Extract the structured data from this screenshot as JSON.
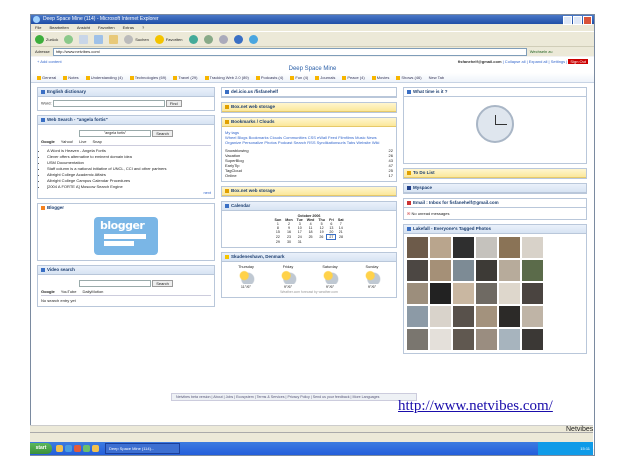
{
  "window": {
    "title": "Deep Space Mine (114) - Microsoft Internet Explorer",
    "menu": [
      "File",
      "Bearbeiten",
      "Ansicht",
      "Favoriten",
      "Extras",
      "?"
    ],
    "toolbar": [
      "Zurück",
      "Suchen",
      "Favoriten"
    ],
    "address_label": "Adresse",
    "address": "http://www.netvibes.com/",
    "go_label": "Wechseln zu"
  },
  "page": {
    "add_content": "+ Add content",
    "title": "Deep Space Mine",
    "account": "fisfanehelf@gmail.com",
    "account_links": "| Collapse all | Expand all | Settings |",
    "sign_out": "Sign Out",
    "tabs": [
      "General",
      "Notes",
      "Understanding (4)",
      "Technologies (69)",
      "Travel (29)",
      "Tracking Web 2.0 (89)",
      "Podcasts (4)",
      "Fun (4)",
      "Journals",
      "Peace (4)",
      "Movies",
      "Shows (46)",
      "New Tab"
    ]
  },
  "widgets": {
    "dictionary": {
      "title": "English dictionary",
      "label": "Word:",
      "button": "Find"
    },
    "websearch": {
      "title": "Web Search - \"angela fortis\"",
      "query": "\"angela fortis\"",
      "button": "Search",
      "tabs": [
        "Google",
        "Yahoo!",
        "Live",
        "Snap"
      ],
      "results": [
        "A Word is Heaven - Angela Fortis",
        "Clever offers alternative to eminent domain idea",
        "USM Documentation",
        "Staff column is a national initiative of UNCL, CCI and other partners",
        "Albright College Academic Affairs",
        "Albright College Campus Calendar Procedures",
        "[2004 A FORTE A] Moscow Search Engine"
      ],
      "next": "next"
    },
    "blogger": {
      "title": "Blogger",
      "logo": "blogger"
    },
    "videosearch": {
      "title": "Video search",
      "button": "Search",
      "tabs": [
        "Google",
        "YouTube",
        "DailyMotion"
      ],
      "status": "No search entry yet"
    },
    "delicious": {
      "title": "del.icio.us /fisfanehelf"
    },
    "webstorage1": {
      "title": "Box.net web storage"
    },
    "bookmarks": {
      "title": "Bookmarks / Clouds",
      "tag": "My tags",
      "cloud": "Wheel Blogs Bookmarks Clouds Communities CSS eWall Feed Filmfilms Music News Organize Personalize Photos Podcast Search RSS Syndikationsurls Tabs Website Wiki",
      "items": [
        "Snowblowing",
        "Vacation",
        "SuperBlog",
        "EarlyTip",
        "TagCloud",
        "Online"
      ],
      "counts": [
        "22",
        "26",
        "43",
        "47",
        "25",
        "17"
      ]
    },
    "webstorage2": {
      "title": "Box.net web storage"
    },
    "calendar": {
      "title": "Calendar",
      "month": "October 2006",
      "days": [
        "Sun",
        "Mon",
        "Tue",
        "Wed",
        "Thu",
        "Fri",
        "Sat"
      ],
      "weeks": [
        [
          "1",
          "2",
          "3",
          "4",
          "5",
          "6",
          "7"
        ],
        [
          "8",
          "9",
          "10",
          "11",
          "12",
          "13",
          "14"
        ],
        [
          "15",
          "16",
          "17",
          "18",
          "19",
          "20",
          "21"
        ],
        [
          "22",
          "23",
          "24",
          "25",
          "26",
          "27",
          "28"
        ],
        [
          "29",
          "30",
          "31",
          "",
          "",
          "",
          ""
        ]
      ]
    },
    "weather": {
      "title": "Skudeneshavn, Denmark",
      "days": [
        "Thursday",
        "Friday",
        "Saturday",
        "Sunday"
      ],
      "temps": [
        "11°/6°",
        "9°/6°",
        "9°/6°",
        "9°/6°"
      ],
      "footer": "Weather.com forecast by weather.com"
    },
    "whattime": {
      "title": "What time is it ?"
    },
    "todo": {
      "title": "To Do List"
    },
    "myspace": {
      "title": "Myspace"
    },
    "email": {
      "title": "Email : Inbox for fisfanehelf@gmail.com",
      "status": "No unread messages"
    },
    "photos": {
      "title": "Lakefall - Everyone's Tagged Photos"
    }
  },
  "footer": {
    "links": "Netvibes beta version | About | Jobs | Ecosystem | Terms & Services | Privacy Policy | Send us your feedback | More Languages"
  },
  "overlay": {
    "link": "http://www.netvibes.com/",
    "label": "Netvibes"
  },
  "taskbar": {
    "start": "start",
    "task": "Deep Space Mine (114)...",
    "clock": "15:11"
  },
  "colors": {
    "accent": "#2a5fa8",
    "widget_header": "#d7e3f3",
    "signout": "#cc0000",
    "link": "#1a0dab",
    "taskbar": "#245edb"
  }
}
